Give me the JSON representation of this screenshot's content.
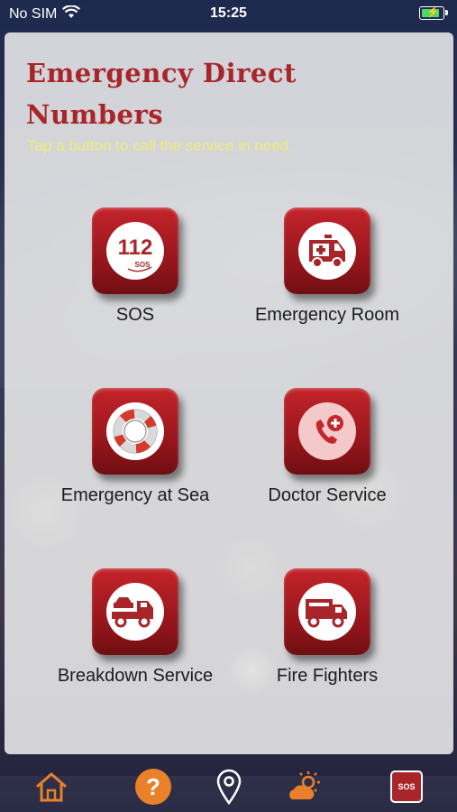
{
  "status": {
    "carrier": "No SIM",
    "time": "15:25"
  },
  "header": {
    "title": "Emergency Direct Numbers",
    "subtitle": "Tap a button to call the service in need."
  },
  "services": [
    {
      "label": "SOS",
      "icon": "sos-112-icon",
      "badge_number": "112",
      "badge_text": "SOS"
    },
    {
      "label": "Emergency Room",
      "icon": "ambulance-icon"
    },
    {
      "label": "Emergency at Sea",
      "icon": "lifebuoy-icon"
    },
    {
      "label": "Doctor Service",
      "icon": "phone-plus-icon"
    },
    {
      "label": "Breakdown Service",
      "icon": "tow-truck-icon"
    },
    {
      "label": "Fire Fighters",
      "icon": "fire-truck-icon"
    }
  ],
  "tabbar": {
    "items": [
      {
        "icon": "home-icon"
      },
      {
        "icon": "help-icon",
        "glyph": "?"
      },
      {
        "icon": "location-pin-icon"
      },
      {
        "icon": "weather-icon"
      },
      {
        "icon": "sos-icon",
        "glyph": "SOS"
      }
    ]
  },
  "colors": {
    "title": "#a8262a",
    "subtitle": "#f0ec7a",
    "button": "#b01e24",
    "tab_accent": "#e8812a"
  }
}
